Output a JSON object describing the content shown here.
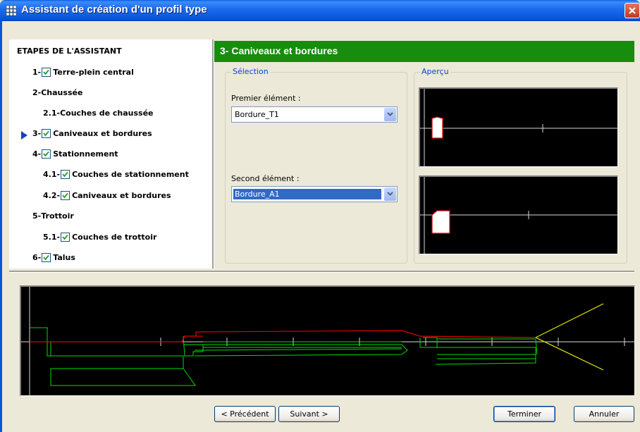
{
  "window": {
    "title": "Assistant de création d'un profil type",
    "title_icon": "grid-icon",
    "close_icon": "close-icon"
  },
  "steps": {
    "title": "ETAPES DE L'ASSISTANT",
    "items": [
      {
        "prefix": "1-",
        "label": "Terre-plein central",
        "checked": true
      },
      {
        "prefix": "2- ",
        "label": "Chaussée",
        "checked": false
      },
      {
        "prefix": "2.1- ",
        "label": "Couches de chaussée",
        "checked": false
      },
      {
        "prefix": "3-",
        "label": "Caniveaux et bordures",
        "checked": true,
        "current": true
      },
      {
        "prefix": "4-",
        "label": "Stationnement",
        "checked": true
      },
      {
        "prefix": "4.1-",
        "label": "Couches de stationnement",
        "checked": true
      },
      {
        "prefix": "4.2-",
        "label": "Caniveaux et bordures",
        "checked": true
      },
      {
        "prefix": "5- ",
        "label": "Trottoir",
        "checked": false
      },
      {
        "prefix": "5.1-",
        "label": "Couches de trottoir",
        "checked": true
      },
      {
        "prefix": "6-",
        "label": "Talus",
        "checked": true
      }
    ]
  },
  "section": {
    "title": "3- Caniveaux et bordures"
  },
  "selection": {
    "group_title": "Sélection",
    "first_label": "Premier élément :",
    "first_value": "Bordure_T1",
    "second_label": "Second élément :",
    "second_value": "Bordure_A1"
  },
  "preview": {
    "group_title": "Aperçu"
  },
  "buttons": {
    "previous": "< Précédent",
    "next": "Suivant >",
    "finish": "Terminer",
    "cancel": "Annuler"
  },
  "colors": {
    "header_bg": "#188c0e",
    "title_bar": "#0a55d8",
    "profile_red": "#e00000",
    "profile_green": "#00dd00",
    "profile_yellow": "#e8e800",
    "current_step_arrow": "#1641c8"
  }
}
